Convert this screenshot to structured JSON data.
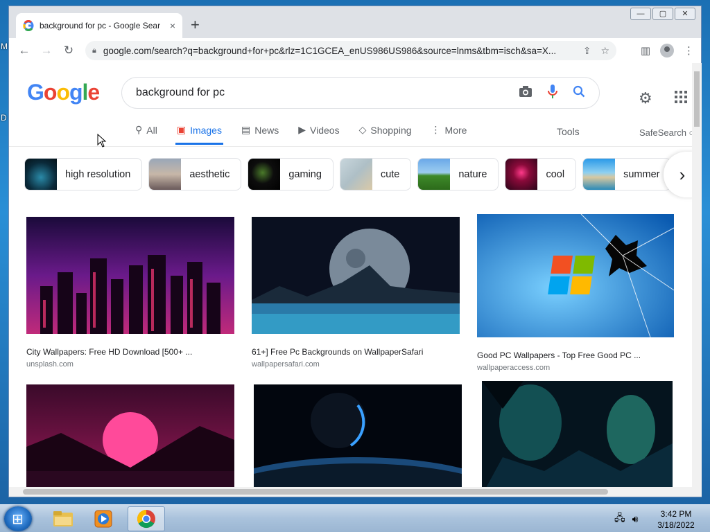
{
  "browser": {
    "tab_title": "background for pc - Google Sear",
    "tab_close": "×",
    "new_tab": "+",
    "url": "google.com/search?q=background+for+pc&rlz=1C1GCEA_enUS986US986&source=lnms&tbm=isch&sa=X...",
    "window_controls": [
      "—",
      "▢",
      "✕"
    ]
  },
  "google": {
    "logo_letters": [
      "G",
      "o",
      "o",
      "g",
      "l",
      "e"
    ],
    "logo_colors": [
      "#4285f4",
      "#ea4335",
      "#fbbc05",
      "#4285f4",
      "#34a853",
      "#ea4335"
    ],
    "query": "background for pc",
    "nav_tabs": [
      {
        "label": "All",
        "icon": "search-icon"
      },
      {
        "label": "Images",
        "icon": "image-icon",
        "active": true
      },
      {
        "label": "News",
        "icon": "news-icon"
      },
      {
        "label": "Videos",
        "icon": "video-icon"
      },
      {
        "label": "Shopping",
        "icon": "tag-icon"
      },
      {
        "label": "More",
        "icon": "more-vert-icon"
      }
    ],
    "tools": "Tools",
    "safesearch": "SafeSearch ○",
    "chips": [
      "high resolution",
      "aesthetic",
      "gaming",
      "cute",
      "nature",
      "cool",
      "summer"
    ],
    "results": [
      {
        "caption": "City Wallpapers: Free HD Download [500+ ...",
        "source": "unsplash.com"
      },
      {
        "caption": "61+] Free Pc Backgrounds on WallpaperSafari",
        "source": "wallpapersafari.com"
      },
      {
        "caption": "Good PC Wallpapers - Top Free Good PC ...",
        "source": "wallpaperaccess.com"
      },
      {
        "caption": "",
        "source": ""
      },
      {
        "caption": "",
        "source": ""
      },
      {
        "caption": "",
        "source": ""
      }
    ]
  },
  "desktop": {
    "left_letters": [
      "M",
      "D"
    ]
  },
  "taskbar": {
    "time": "3:42 PM",
    "date": "3/18/2022"
  }
}
